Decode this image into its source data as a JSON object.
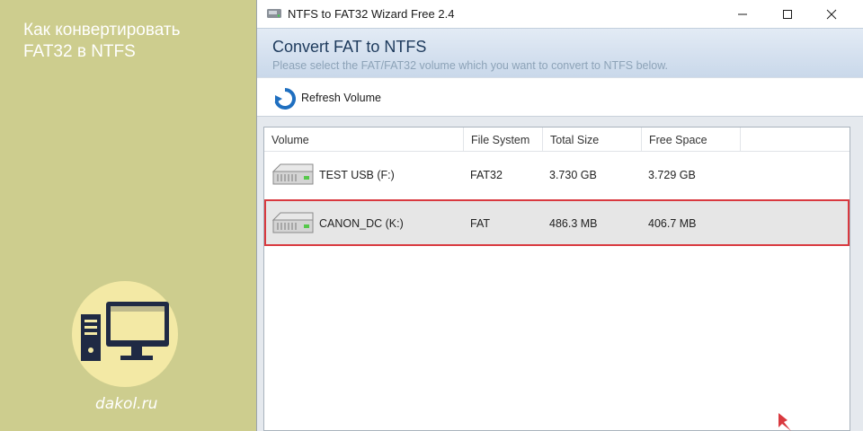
{
  "side_panel": {
    "title_lines": [
      "Как конвертировать",
      "FAT32 в NTFS"
    ],
    "site": "dakol.ru",
    "colors": {
      "background": "#cdcd8e",
      "circle": "#f3e9a5",
      "icon": "#1f2a44"
    }
  },
  "window": {
    "title": "NTFS to FAT32 Wizard Free 2.4",
    "controls": {
      "minimize": "–",
      "maximize": "☐",
      "close": "✕"
    }
  },
  "header": {
    "title": "Convert FAT to NTFS",
    "subtitle": "Please select the FAT/FAT32 volume which you want to convert to NTFS below."
  },
  "toolbar": {
    "refresh_label": "Refresh Volume",
    "icon": "refresh-icon"
  },
  "table": {
    "columns": [
      "Volume",
      "File System",
      "Total Size",
      "Free Space"
    ],
    "rows": [
      {
        "volume": "TEST USB (F:)",
        "file_system": "FAT32",
        "total_size": "3.730 GB",
        "free_space": "3.729 GB",
        "selected": false
      },
      {
        "volume": "CANON_DC (K:)",
        "file_system": "FAT",
        "total_size": "486.3 MB",
        "free_space": "406.7 MB",
        "selected": true
      }
    ]
  },
  "colors": {
    "selection_border": "#d9393f",
    "selection_bg": "#e6e6e6",
    "header_text": "#1d3a5c"
  }
}
